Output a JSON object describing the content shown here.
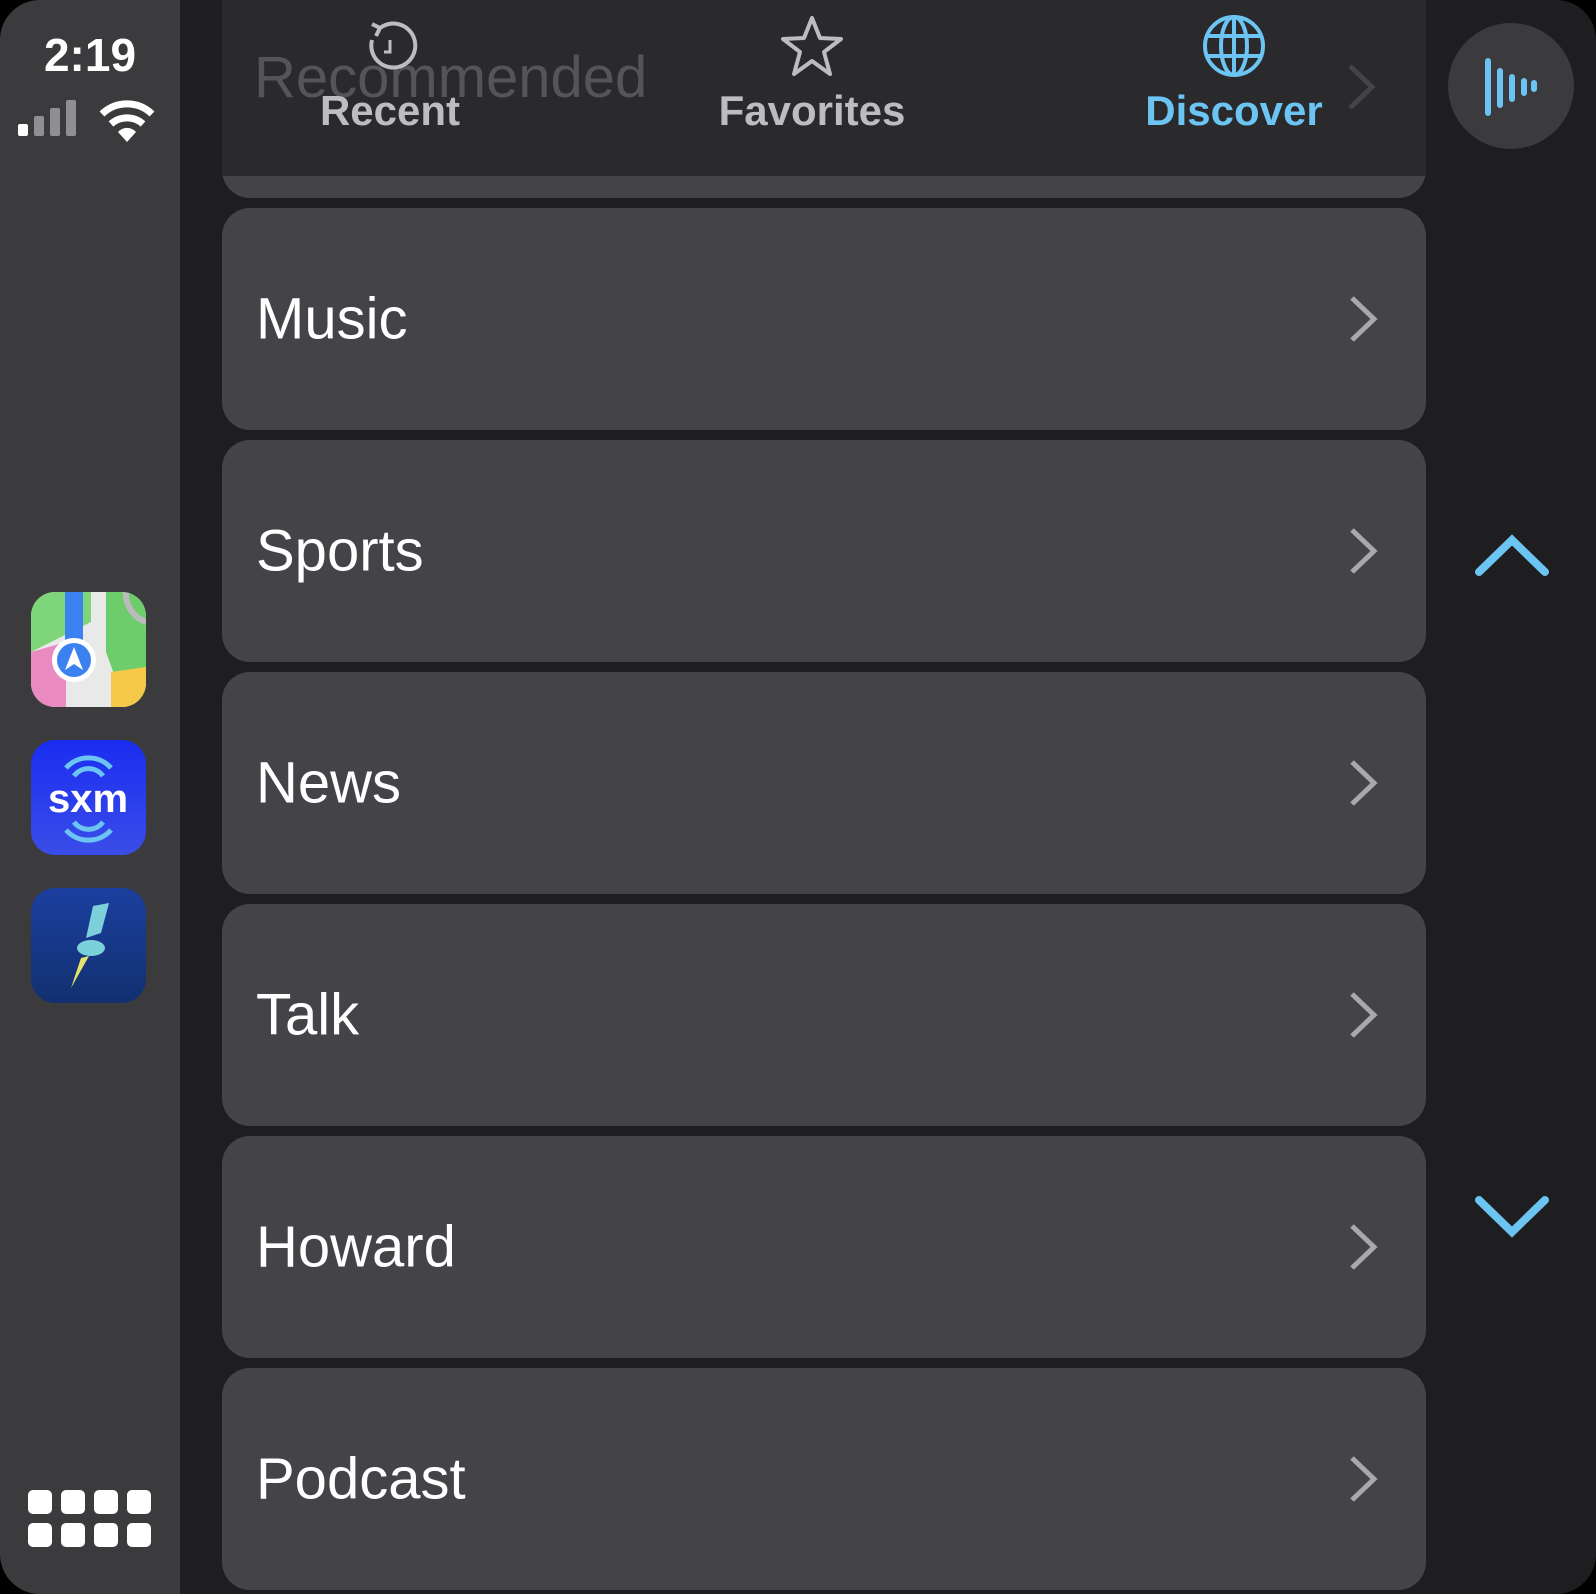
{
  "status": {
    "time": "2:19",
    "signal": "signal-icon",
    "wifi": "wifi-icon"
  },
  "dock": {
    "apps": [
      "Maps",
      "SiriusXM",
      "App"
    ],
    "apps_grid": "app-grid-icon"
  },
  "header": {
    "behind_title": "Recommended",
    "tabs": [
      {
        "label": "Recent",
        "icon": "history-icon"
      },
      {
        "label": "Favorites",
        "icon": "star-icon"
      },
      {
        "label": "Discover",
        "icon": "globe-icon",
        "active": true
      }
    ]
  },
  "categories": [
    {
      "label": "Music"
    },
    {
      "label": "Sports"
    },
    {
      "label": "News"
    },
    {
      "label": "Talk"
    },
    {
      "label": "Howard"
    },
    {
      "label": "Podcast"
    }
  ],
  "colors": {
    "accent": "#6cc4f2",
    "row": "#444448",
    "sidebar": "#3b3b3e"
  }
}
